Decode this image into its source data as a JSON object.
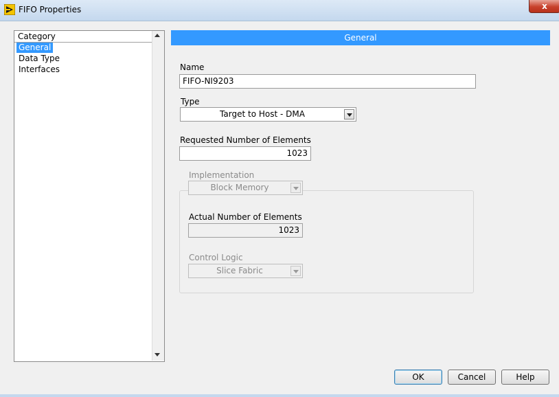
{
  "window": {
    "title": "FIFO Properties",
    "close_label": "x"
  },
  "category": {
    "header": "Category",
    "items": [
      "General",
      "Data Type",
      "Interfaces"
    ],
    "selected": "General"
  },
  "section": {
    "title": "General"
  },
  "form": {
    "name_label": "Name",
    "name_value": "FIFO-NI9203",
    "type_label": "Type",
    "type_value": "Target to Host - DMA",
    "requested_label": "Requested Number of Elements",
    "requested_value": "1023",
    "implementation_label": "Implementation",
    "implementation_value": "Block Memory",
    "actual_label": "Actual Number of Elements",
    "actual_value": "1023",
    "control_logic_label": "Control Logic",
    "control_logic_value": "Slice Fabric"
  },
  "buttons": {
    "ok": "OK",
    "cancel": "Cancel",
    "help": "Help"
  },
  "colors": {
    "accent": "#3399ff",
    "titlebar": "#c4d8ee",
    "close": "#c8412c"
  }
}
